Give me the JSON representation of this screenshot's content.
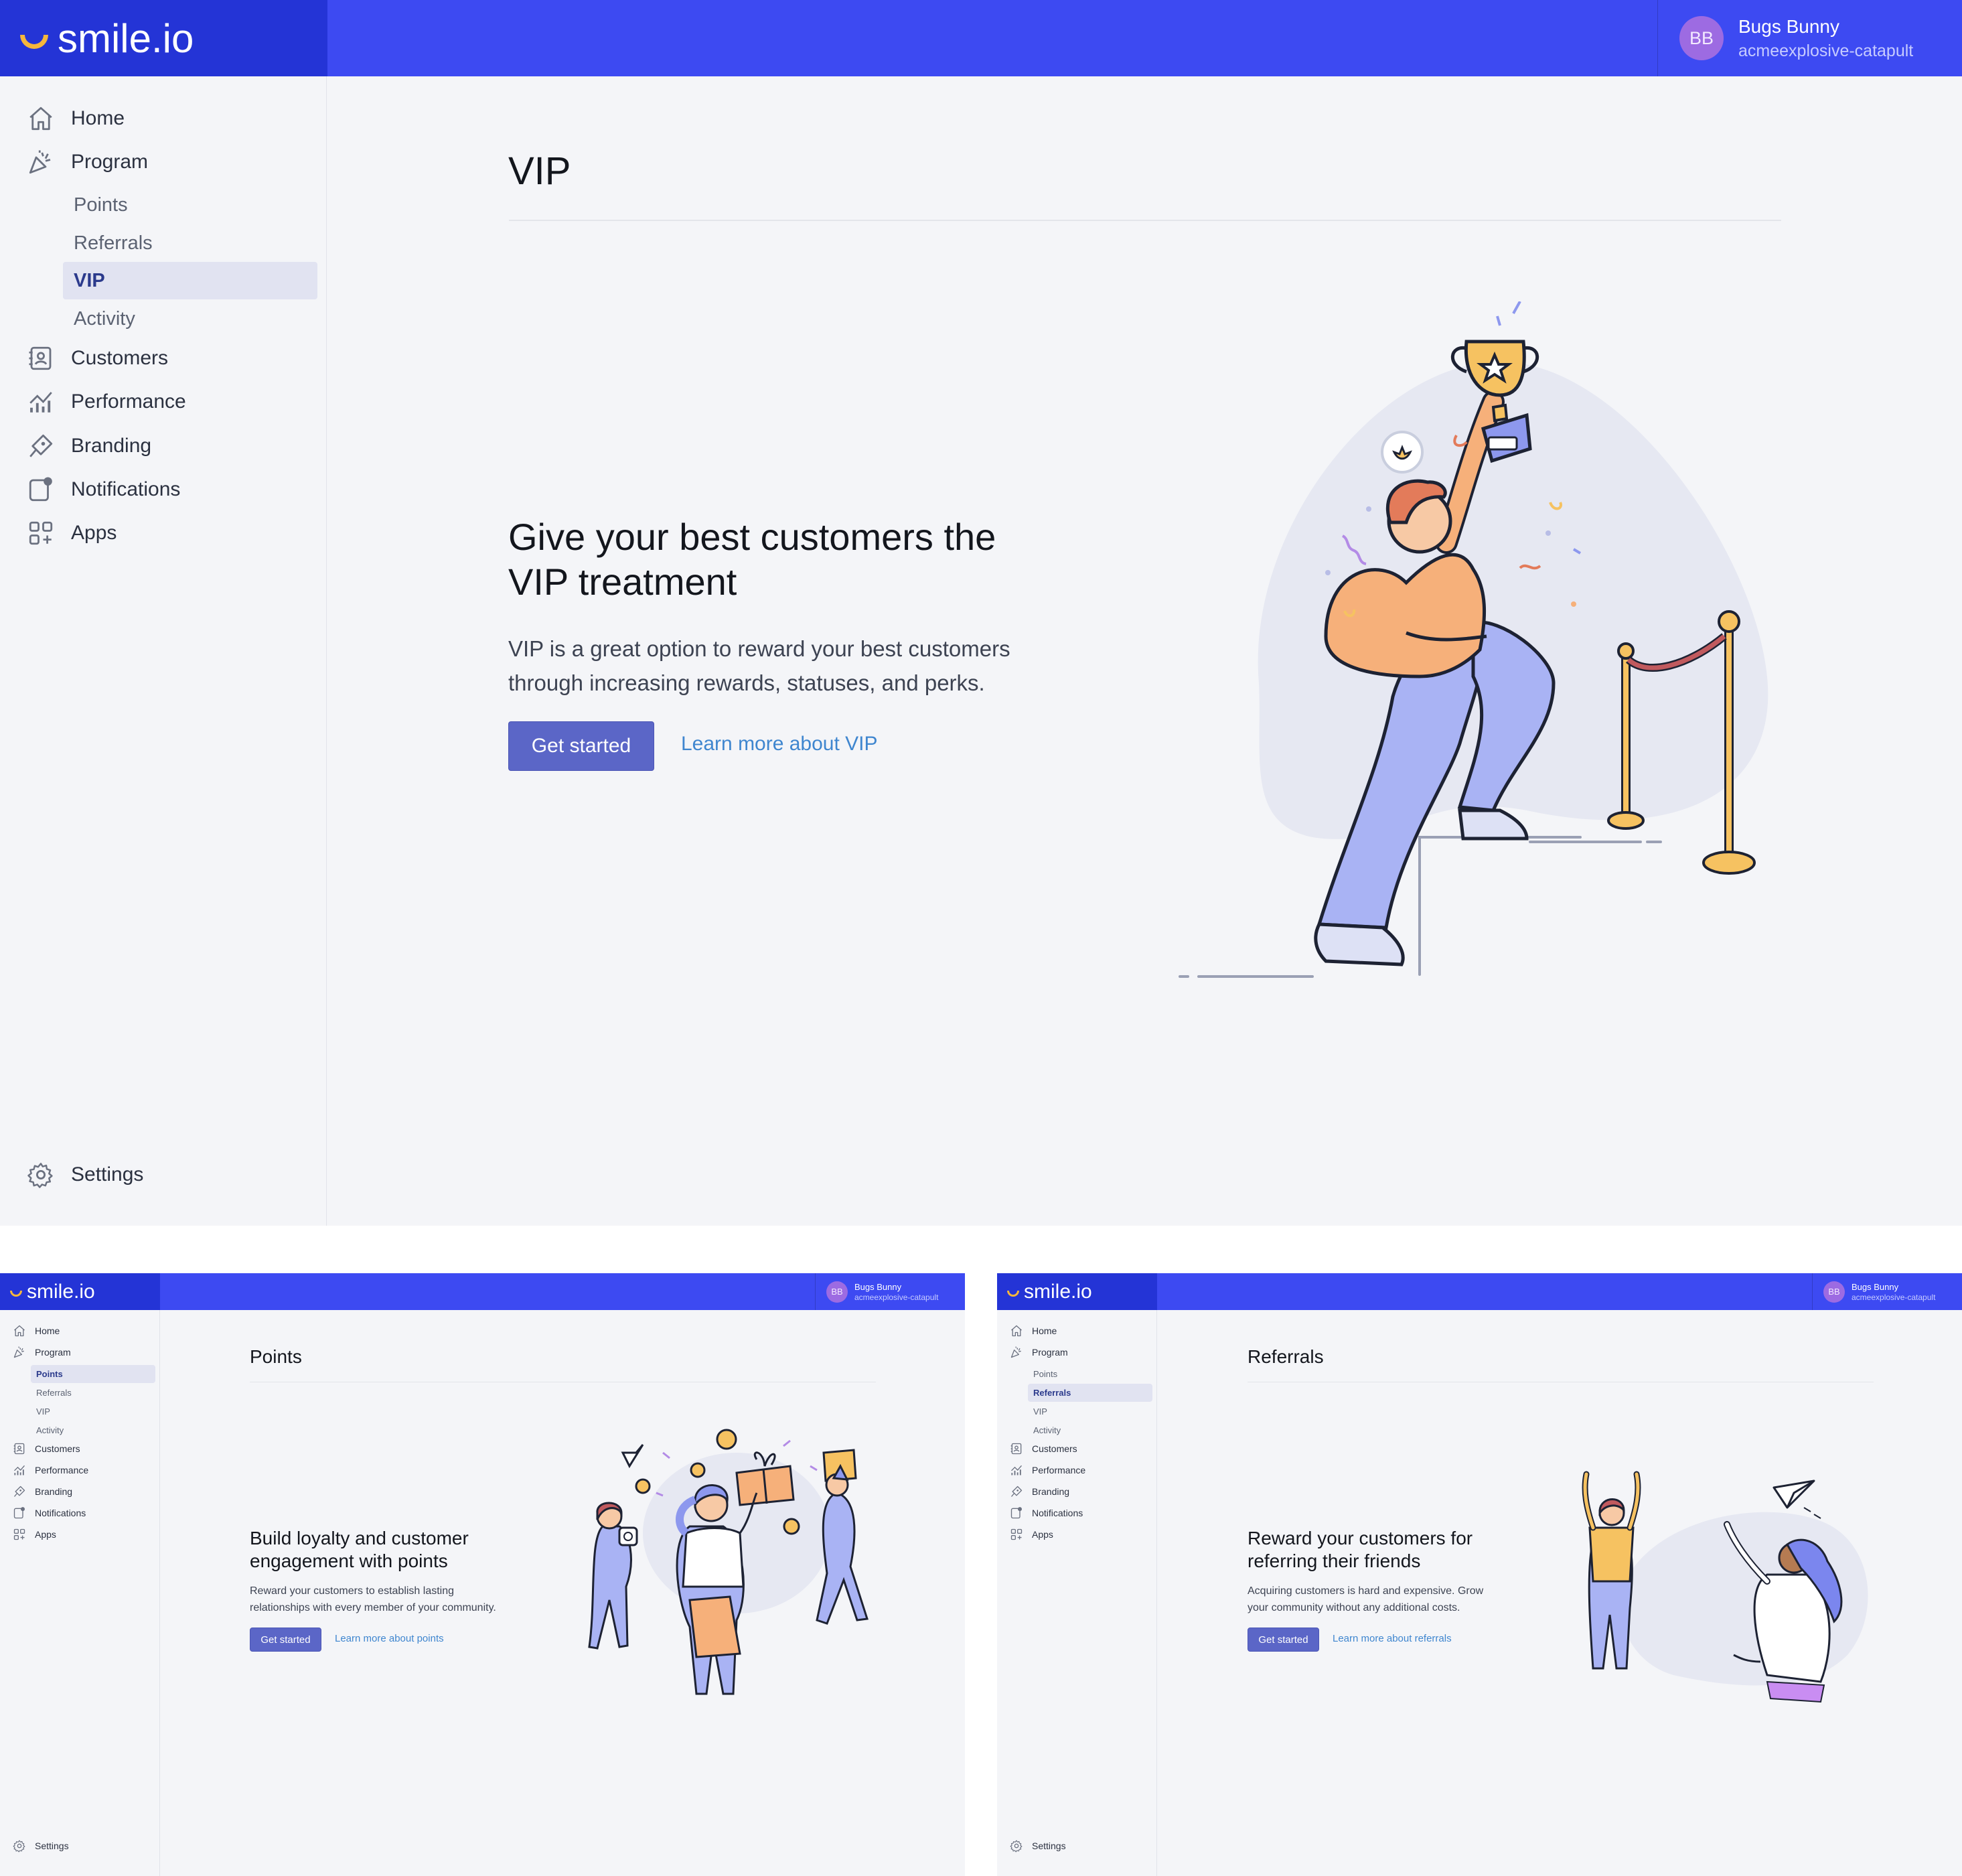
{
  "app": {
    "logo_text": "smile.io",
    "user_initials": "BB",
    "user_name": "Bugs Bunny",
    "user_shop": "acmeexplosive-catapult"
  },
  "sidebar": {
    "home": "Home",
    "program": "Program",
    "sub": {
      "points": "Points",
      "referrals": "Referrals",
      "vip": "VIP",
      "activity": "Activity"
    },
    "customers": "Customers",
    "performance": "Performance",
    "branding": "Branding",
    "notifications": "Notifications",
    "apps": "Apps",
    "settings": "Settings"
  },
  "vip": {
    "page_title": "VIP",
    "hero_title_line1": "Give your best customers the",
    "hero_title_line2": "VIP treatment",
    "body_line1": "VIP is a great option to reward your best customers",
    "body_line2": "through increasing rewards, statuses, and perks.",
    "cta": "Get started",
    "learn_more": "Learn more about VIP"
  },
  "points": {
    "page_title": "Points",
    "hero_title_line1": "Build loyalty and customer",
    "hero_title_line2": "engagement with points",
    "body_line1": "Reward your customers to establish lasting",
    "body_line2": "relationships with every member of your community.",
    "cta": "Get started",
    "learn_more": "Learn more about points"
  },
  "referrals": {
    "page_title": "Referrals",
    "hero_title_line1": "Reward your customers for",
    "hero_title_line2": "referring their friends",
    "body_line1": "Acquiring customers is hard and expensive. Grow",
    "body_line2": "your community without any additional costs.",
    "cta": "Get started",
    "learn_more": "Learn more about referrals"
  },
  "colors": {
    "topbar": "#3d4af2",
    "brand_block": "#2434d6",
    "logo_smile": "#f6b73c",
    "avatar": "#9d6be2",
    "button": "#5b66c7",
    "link": "#3f86cf",
    "active_nav_bg": "#e1e3f1",
    "page_bg": "#f4f5f8"
  }
}
